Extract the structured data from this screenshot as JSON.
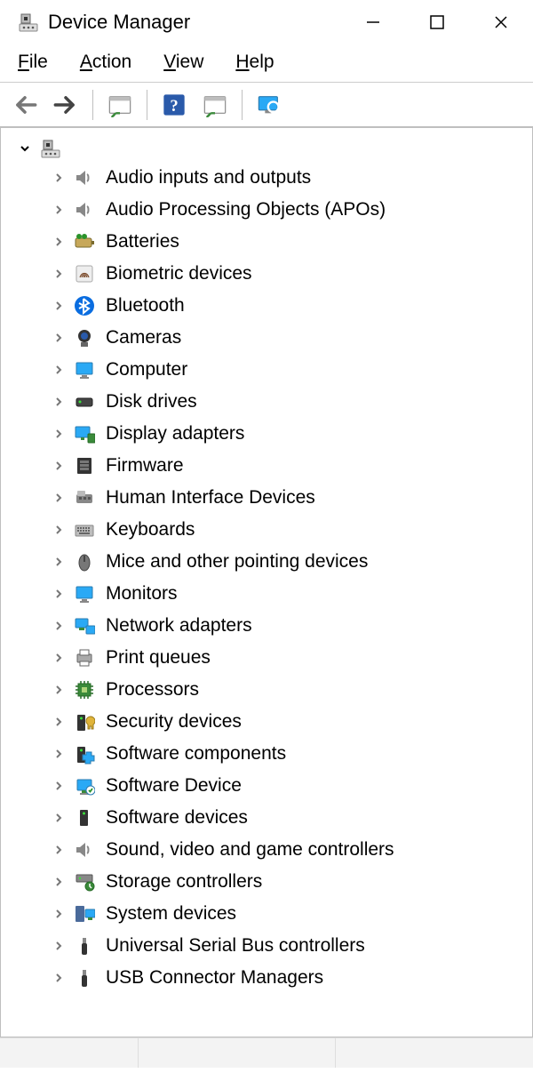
{
  "window": {
    "title": "Device Manager"
  },
  "menu": {
    "file": "File",
    "action": "Action",
    "view": "View",
    "help": "Help"
  },
  "toolbar": {
    "back": "Back",
    "forward": "Forward",
    "show_hidden": "Show hidden devices",
    "help": "Help",
    "scan": "Scan for hardware changes",
    "properties": "Properties"
  },
  "tree": {
    "root_computer_name": "",
    "categories": [
      {
        "icon": "audio-icon",
        "label": "Audio inputs and outputs"
      },
      {
        "icon": "audio-icon",
        "label": "Audio Processing Objects (APOs)"
      },
      {
        "icon": "battery-icon",
        "label": "Batteries"
      },
      {
        "icon": "biometric-icon",
        "label": "Biometric devices"
      },
      {
        "icon": "bluetooth-icon",
        "label": "Bluetooth"
      },
      {
        "icon": "camera-icon",
        "label": "Cameras"
      },
      {
        "icon": "computer-icon",
        "label": "Computer"
      },
      {
        "icon": "disk-icon",
        "label": "Disk drives"
      },
      {
        "icon": "display-adapter-icon",
        "label": "Display adapters"
      },
      {
        "icon": "firmware-icon",
        "label": "Firmware"
      },
      {
        "icon": "hid-icon",
        "label": "Human Interface Devices"
      },
      {
        "icon": "keyboard-icon",
        "label": "Keyboards"
      },
      {
        "icon": "mouse-icon",
        "label": "Mice and other pointing devices"
      },
      {
        "icon": "monitor-icon",
        "label": "Monitors"
      },
      {
        "icon": "network-icon",
        "label": "Network adapters"
      },
      {
        "icon": "printer-icon",
        "label": "Print queues"
      },
      {
        "icon": "processor-icon",
        "label": "Processors"
      },
      {
        "icon": "security-icon",
        "label": "Security devices"
      },
      {
        "icon": "software-component-icon",
        "label": "Software components"
      },
      {
        "icon": "software-device-icon",
        "label": "Software Device"
      },
      {
        "icon": "software-devices-icon",
        "label": "Software devices"
      },
      {
        "icon": "sound-icon",
        "label": "Sound, video and game controllers"
      },
      {
        "icon": "storage-icon",
        "label": "Storage controllers"
      },
      {
        "icon": "system-icon",
        "label": "System devices"
      },
      {
        "icon": "usb-icon",
        "label": "Universal Serial Bus controllers"
      },
      {
        "icon": "usb-connector-icon",
        "label": "USB Connector Managers"
      }
    ]
  }
}
